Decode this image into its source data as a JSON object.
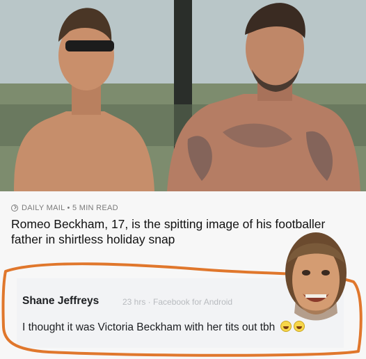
{
  "photo": {
    "alt": ""
  },
  "article": {
    "source": "DAILY MAIL • 5 MIN READ",
    "headline": "Romeo Beckham, 17, is the spitting image of his footballer father in shirtless holiday snap"
  },
  "comment": {
    "author": "Shane Jeffreys",
    "meta": "23 hrs · Facebook for Android",
    "text": "I thought it was Victoria Beckham with her tits out tbh"
  },
  "colors": {
    "highlight_outline": "#e0772c",
    "meta_text": "#7a7a7a"
  }
}
